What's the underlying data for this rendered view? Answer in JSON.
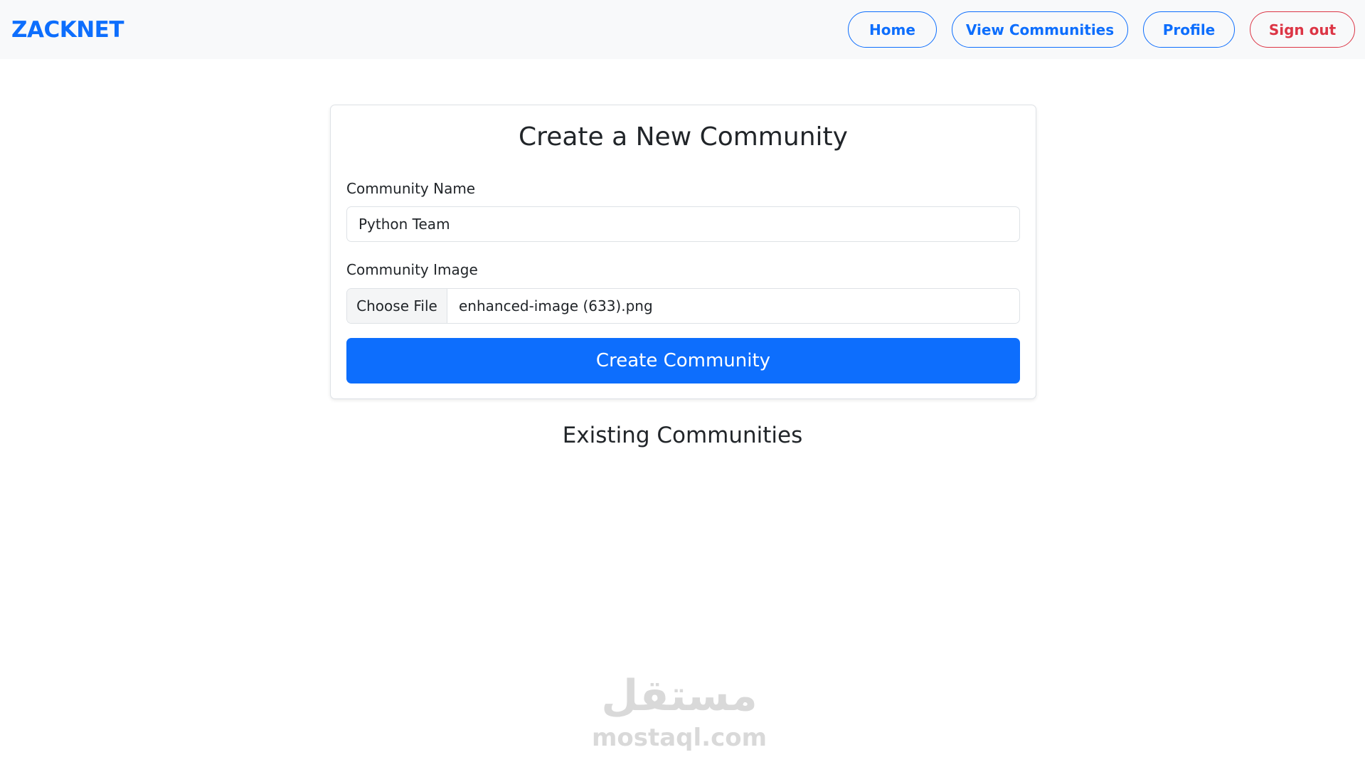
{
  "navbar": {
    "brand": "ZACKNET",
    "links": {
      "home": "Home",
      "view_communities": "View Communities",
      "profile": "Profile",
      "sign_out": "Sign out"
    }
  },
  "form": {
    "title": "Create a New Community",
    "name_label": "Community Name",
    "name_value": "Python Team",
    "image_label": "Community Image",
    "choose_file_label": "Choose File",
    "file_name": "enhanced-image (633).png",
    "submit_label": "Create Community"
  },
  "existing": {
    "title": "Existing Communities"
  },
  "watermark": {
    "logo_text": "مستقل",
    "domain": "mostaql.com"
  },
  "colors": {
    "primary": "#0d6efd",
    "danger": "#dc3545",
    "navbar_bg": "#f8f9fa",
    "text": "#212529"
  }
}
